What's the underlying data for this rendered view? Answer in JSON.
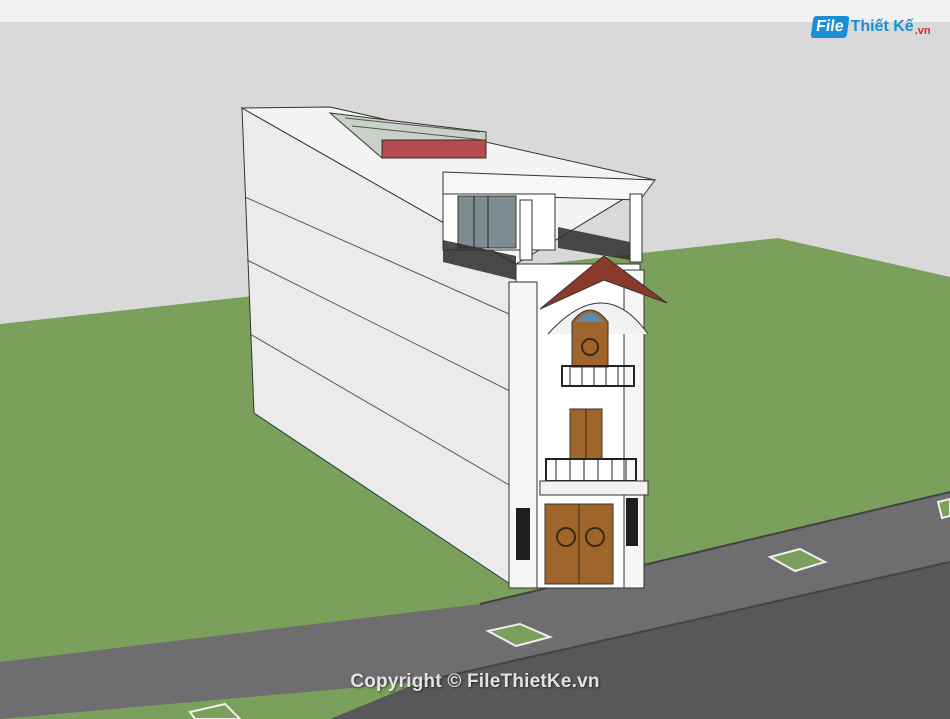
{
  "logo": {
    "badge": "File",
    "name": "Thiết Kế",
    "suffix": ".vn"
  },
  "watermark": "Copyright © FileThietKe.vn",
  "colors": {
    "background": "#d9d9d9",
    "lawn": "#7ba05b",
    "road": "#5a5a5c",
    "roof_tile": "#8b3a2a",
    "wood_door": "#a0652a"
  }
}
